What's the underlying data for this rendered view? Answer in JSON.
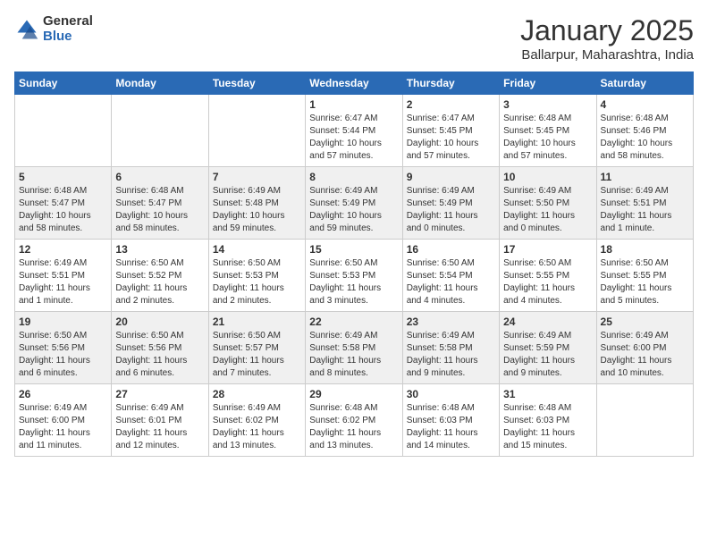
{
  "header": {
    "logo_general": "General",
    "logo_blue": "Blue",
    "month_title": "January 2025",
    "location": "Ballarpur, Maharashtra, India"
  },
  "weekdays": [
    "Sunday",
    "Monday",
    "Tuesday",
    "Wednesday",
    "Thursday",
    "Friday",
    "Saturday"
  ],
  "weeks": [
    [
      {
        "day": "",
        "info": ""
      },
      {
        "day": "",
        "info": ""
      },
      {
        "day": "",
        "info": ""
      },
      {
        "day": "1",
        "info": "Sunrise: 6:47 AM\nSunset: 5:44 PM\nDaylight: 10 hours\nand 57 minutes."
      },
      {
        "day": "2",
        "info": "Sunrise: 6:47 AM\nSunset: 5:45 PM\nDaylight: 10 hours\nand 57 minutes."
      },
      {
        "day": "3",
        "info": "Sunrise: 6:48 AM\nSunset: 5:45 PM\nDaylight: 10 hours\nand 57 minutes."
      },
      {
        "day": "4",
        "info": "Sunrise: 6:48 AM\nSunset: 5:46 PM\nDaylight: 10 hours\nand 58 minutes."
      }
    ],
    [
      {
        "day": "5",
        "info": "Sunrise: 6:48 AM\nSunset: 5:47 PM\nDaylight: 10 hours\nand 58 minutes."
      },
      {
        "day": "6",
        "info": "Sunrise: 6:48 AM\nSunset: 5:47 PM\nDaylight: 10 hours\nand 58 minutes."
      },
      {
        "day": "7",
        "info": "Sunrise: 6:49 AM\nSunset: 5:48 PM\nDaylight: 10 hours\nand 59 minutes."
      },
      {
        "day": "8",
        "info": "Sunrise: 6:49 AM\nSunset: 5:49 PM\nDaylight: 10 hours\nand 59 minutes."
      },
      {
        "day": "9",
        "info": "Sunrise: 6:49 AM\nSunset: 5:49 PM\nDaylight: 11 hours\nand 0 minutes."
      },
      {
        "day": "10",
        "info": "Sunrise: 6:49 AM\nSunset: 5:50 PM\nDaylight: 11 hours\nand 0 minutes."
      },
      {
        "day": "11",
        "info": "Sunrise: 6:49 AM\nSunset: 5:51 PM\nDaylight: 11 hours\nand 1 minute."
      }
    ],
    [
      {
        "day": "12",
        "info": "Sunrise: 6:49 AM\nSunset: 5:51 PM\nDaylight: 11 hours\nand 1 minute."
      },
      {
        "day": "13",
        "info": "Sunrise: 6:50 AM\nSunset: 5:52 PM\nDaylight: 11 hours\nand 2 minutes."
      },
      {
        "day": "14",
        "info": "Sunrise: 6:50 AM\nSunset: 5:53 PM\nDaylight: 11 hours\nand 2 minutes."
      },
      {
        "day": "15",
        "info": "Sunrise: 6:50 AM\nSunset: 5:53 PM\nDaylight: 11 hours\nand 3 minutes."
      },
      {
        "day": "16",
        "info": "Sunrise: 6:50 AM\nSunset: 5:54 PM\nDaylight: 11 hours\nand 4 minutes."
      },
      {
        "day": "17",
        "info": "Sunrise: 6:50 AM\nSunset: 5:55 PM\nDaylight: 11 hours\nand 4 minutes."
      },
      {
        "day": "18",
        "info": "Sunrise: 6:50 AM\nSunset: 5:55 PM\nDaylight: 11 hours\nand 5 minutes."
      }
    ],
    [
      {
        "day": "19",
        "info": "Sunrise: 6:50 AM\nSunset: 5:56 PM\nDaylight: 11 hours\nand 6 minutes."
      },
      {
        "day": "20",
        "info": "Sunrise: 6:50 AM\nSunset: 5:56 PM\nDaylight: 11 hours\nand 6 minutes."
      },
      {
        "day": "21",
        "info": "Sunrise: 6:50 AM\nSunset: 5:57 PM\nDaylight: 11 hours\nand 7 minutes."
      },
      {
        "day": "22",
        "info": "Sunrise: 6:49 AM\nSunset: 5:58 PM\nDaylight: 11 hours\nand 8 minutes."
      },
      {
        "day": "23",
        "info": "Sunrise: 6:49 AM\nSunset: 5:58 PM\nDaylight: 11 hours\nand 9 minutes."
      },
      {
        "day": "24",
        "info": "Sunrise: 6:49 AM\nSunset: 5:59 PM\nDaylight: 11 hours\nand 9 minutes."
      },
      {
        "day": "25",
        "info": "Sunrise: 6:49 AM\nSunset: 6:00 PM\nDaylight: 11 hours\nand 10 minutes."
      }
    ],
    [
      {
        "day": "26",
        "info": "Sunrise: 6:49 AM\nSunset: 6:00 PM\nDaylight: 11 hours\nand 11 minutes."
      },
      {
        "day": "27",
        "info": "Sunrise: 6:49 AM\nSunset: 6:01 PM\nDaylight: 11 hours\nand 12 minutes."
      },
      {
        "day": "28",
        "info": "Sunrise: 6:49 AM\nSunset: 6:02 PM\nDaylight: 11 hours\nand 13 minutes."
      },
      {
        "day": "29",
        "info": "Sunrise: 6:48 AM\nSunset: 6:02 PM\nDaylight: 11 hours\nand 13 minutes."
      },
      {
        "day": "30",
        "info": "Sunrise: 6:48 AM\nSunset: 6:03 PM\nDaylight: 11 hours\nand 14 minutes."
      },
      {
        "day": "31",
        "info": "Sunrise: 6:48 AM\nSunset: 6:03 PM\nDaylight: 11 hours\nand 15 minutes."
      },
      {
        "day": "",
        "info": ""
      }
    ]
  ]
}
